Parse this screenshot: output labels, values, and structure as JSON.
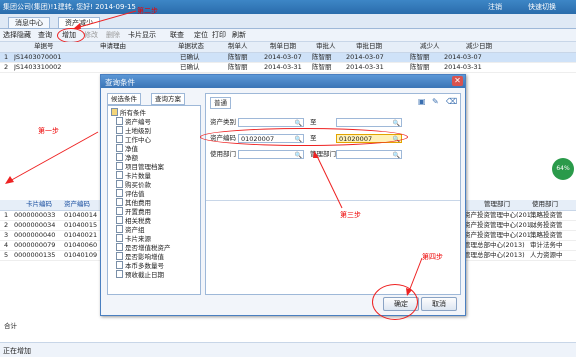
{
  "topbar": {
    "left": "集团公司(集团)!1建转, 您好! 2014-09-15",
    "logout": "注销",
    "quick": "快速切换"
  },
  "tabs": [
    "消息中心",
    "资产减少"
  ],
  "toolbar": [
    "选择隐藏",
    "查询",
    "增加",
    "修改",
    "删除",
    "卡片显示",
    "联查",
    "定位",
    "打印",
    "刷新"
  ],
  "grid": {
    "headers": [
      "单据号",
      "申请理由",
      "单据状态",
      "制单人",
      "制单日期",
      "审批人",
      "审批日期",
      "减少人",
      "减少日期"
    ],
    "rows": [
      [
        "1",
        "JS1403070001",
        "",
        "已确认",
        "陈智丽",
        "2014-03-07",
        "陈智丽",
        "2014-03-07",
        "陈智丽",
        "2014-03-07"
      ],
      [
        "2",
        "JS1403310002",
        "",
        "已确认",
        "陈智丽",
        "2014-03-31",
        "陈智丽",
        "2014-03-31",
        "陈智丽",
        "2014-03-31"
      ]
    ]
  },
  "grid2": {
    "headers": [
      "卡片编码",
      "资产编码",
      "管理部门",
      "使用部门"
    ],
    "rows": [
      [
        "1",
        "0000000033",
        "01040014",
        "资产投资管理中心(201...",
        "策略投资管"
      ],
      [
        "2",
        "0000000034",
        "01040015",
        "资产投资管理中心(201...",
        "财务投资管"
      ],
      [
        "3",
        "0000000040",
        "01040021",
        "资产投资管理中心(201...",
        "策略投资管"
      ],
      [
        "4",
        "0000000079",
        "01040060",
        "管理总部中心(2013)",
        "审计法务中"
      ],
      [
        "5",
        "0000000135",
        "01040109",
        "管理总部中心(2013)",
        "人力资源中"
      ]
    ],
    "total_label": "合计"
  },
  "status": "正在增加",
  "annotations": {
    "step1": "第一步",
    "step2": "第二步",
    "step3": "第三步",
    "step4": "第四步",
    "badge": "64%"
  },
  "dialog": {
    "title": "查询条件",
    "left_tabs": [
      "候选条件",
      "查询方案"
    ],
    "right_tab": "普通",
    "tree_root": "所有条件",
    "tree_items": [
      "资产编号",
      "土地级别",
      "工作中心",
      "净值",
      "净额",
      "项目管理档案",
      "卡片数量",
      "购买价款",
      "评估值",
      "其他费用",
      "开置费用",
      "相关税费",
      "资产组",
      "卡片来源",
      "是否增值税资产",
      "是否影响增值",
      "本币多数量号",
      "预收截止日期"
    ],
    "fields": {
      "category_label": "资产类别",
      "to1": "至",
      "code_label": "资产编码",
      "code_from": "01020007",
      "to2": "至",
      "code_to": "01020007",
      "use_dept_label": "使用部门",
      "mgmt_dept_label": "管理部门"
    },
    "ok": "确定",
    "cancel": "取消"
  }
}
